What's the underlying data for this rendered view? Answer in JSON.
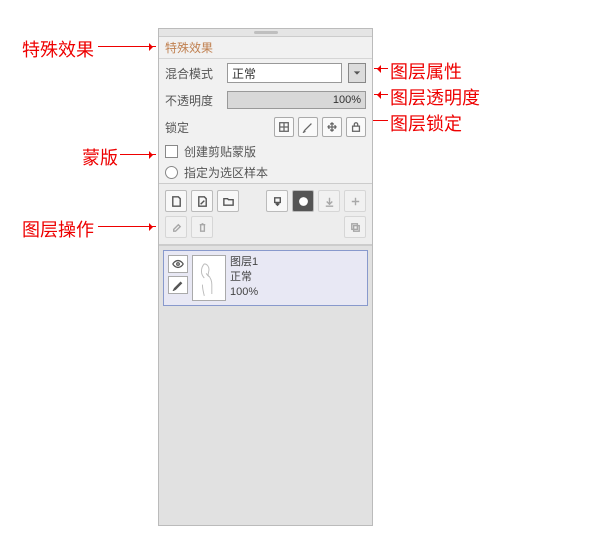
{
  "panel": {
    "section_title": "特殊效果",
    "blend_label": "混合模式",
    "blend_value": "正常",
    "opacity_label": "不透明度",
    "opacity_value": "100%",
    "lock_label": "锁定",
    "clip_label": "创建剪贴蒙版",
    "sample_label": "指定为选区样本"
  },
  "layer": {
    "name": "图层1",
    "mode": "正常",
    "opacity": "100%"
  },
  "anno": {
    "special": "特殊效果",
    "props": "图层属性",
    "opacity": "图层透明度",
    "lock": "图层锁定",
    "mask": "蒙版",
    "ops": "图层操作"
  }
}
